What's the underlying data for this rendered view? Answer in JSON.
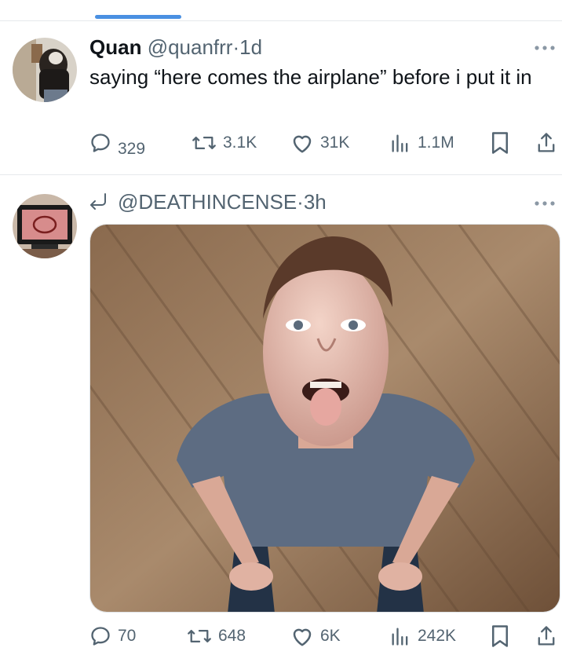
{
  "tweet1": {
    "name": "Quan",
    "handle": "@quanfrr",
    "dot": "·",
    "time": "1d",
    "text": "saying “here comes the airplane” before i put it in",
    "replies": "329",
    "retweets": "3.1K",
    "likes": "31K",
    "views": "1.1M"
  },
  "tweet2": {
    "handle": "@DEATHINCENSE",
    "dot": "·",
    "time": "3h",
    "replies": "70",
    "retweets": "648",
    "likes": "6K",
    "views": "242K"
  },
  "icons": {
    "reply": "reply-icon",
    "retweet": "retweet-icon",
    "like": "heart-icon",
    "views": "views-icon",
    "bookmark": "bookmark-icon",
    "share": "share-icon",
    "more": "more-icon",
    "reply_context": "reply-arrow-icon"
  },
  "colors": {
    "text": "#0f1419",
    "secondary": "#536471",
    "accent": "#4a90e2"
  }
}
